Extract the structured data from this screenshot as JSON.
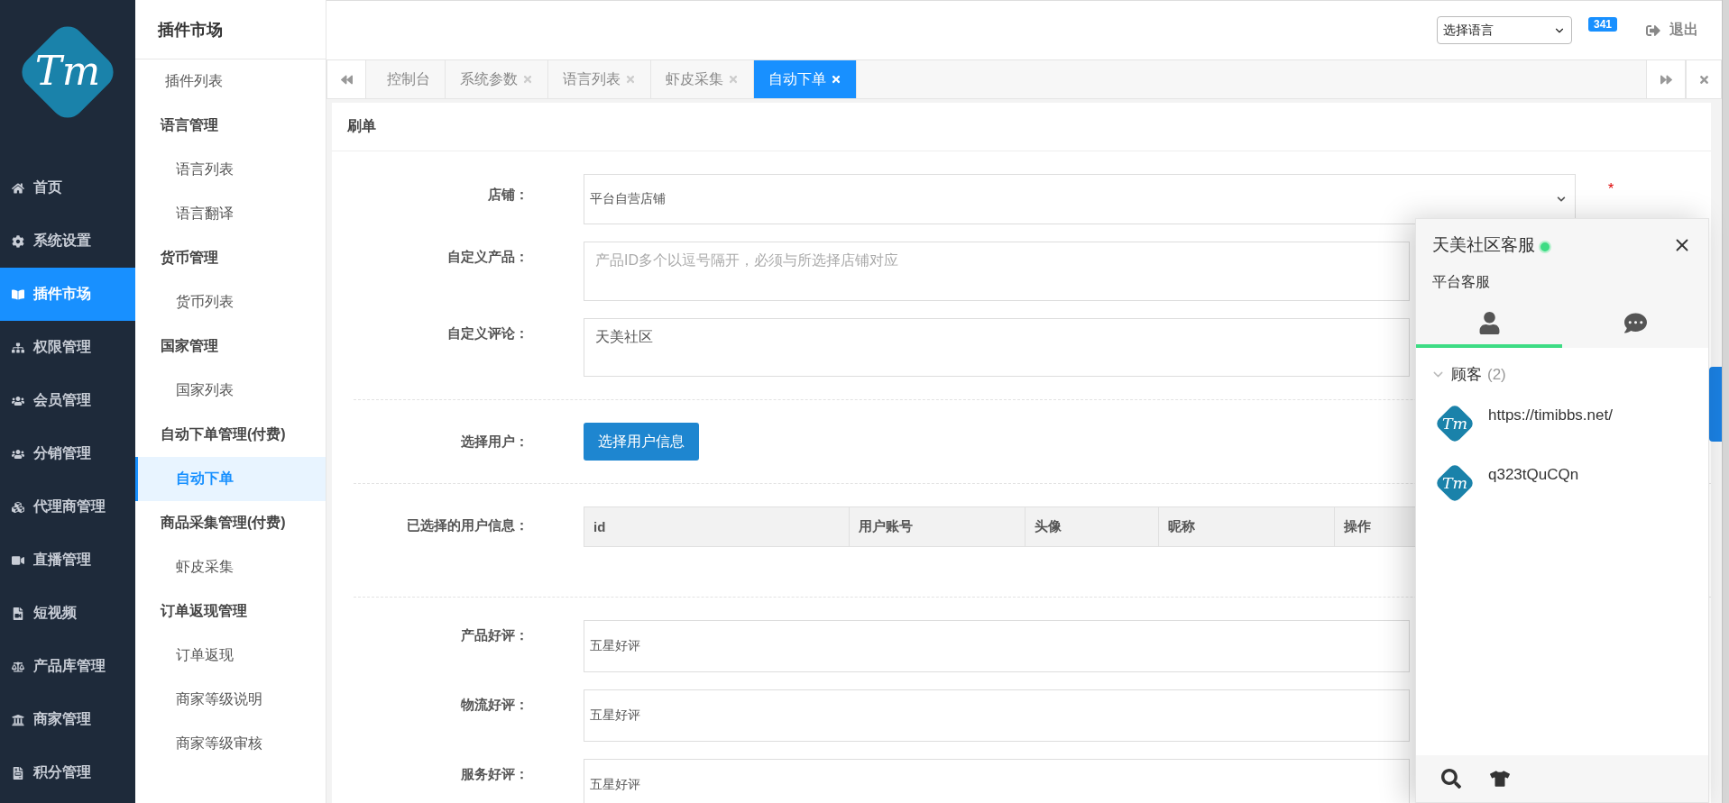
{
  "logo": {
    "text": "Tm"
  },
  "nav": [
    {
      "label": "首页",
      "selected": false
    },
    {
      "label": "系统设置",
      "selected": false
    },
    {
      "label": "插件市场",
      "selected": true
    },
    {
      "label": "权限管理",
      "selected": false
    },
    {
      "label": "会员管理",
      "selected": false
    },
    {
      "label": "分销管理",
      "selected": false
    },
    {
      "label": "代理商管理",
      "selected": false
    },
    {
      "label": "直播管理",
      "selected": false
    },
    {
      "label": "短视频",
      "selected": false
    },
    {
      "label": "产品库管理",
      "selected": false
    },
    {
      "label": "商家管理",
      "selected": false
    },
    {
      "label": "积分管理",
      "selected": false
    }
  ],
  "submenu": {
    "title": "插件市场",
    "items": [
      {
        "kind": "top",
        "label": "插件列表",
        "selected": false
      },
      {
        "kind": "group",
        "label": "语言管理"
      },
      {
        "kind": "sub",
        "label": "语言列表",
        "selected": false
      },
      {
        "kind": "sub",
        "label": "语言翻译",
        "selected": false
      },
      {
        "kind": "group",
        "label": "货币管理"
      },
      {
        "kind": "sub",
        "label": "货币列表",
        "selected": false
      },
      {
        "kind": "group",
        "label": "国家管理"
      },
      {
        "kind": "sub",
        "label": "国家列表",
        "selected": false
      },
      {
        "kind": "group",
        "label": "自动下单管理(付费)"
      },
      {
        "kind": "sub",
        "label": "自动下单",
        "selected": true
      },
      {
        "kind": "group",
        "label": "商品采集管理(付费)"
      },
      {
        "kind": "sub",
        "label": "虾皮采集",
        "selected": false
      },
      {
        "kind": "group",
        "label": "订单返现管理"
      },
      {
        "kind": "sub",
        "label": "订单返现",
        "selected": false
      },
      {
        "kind": "sub",
        "label": "商家等级说明",
        "selected": false
      },
      {
        "kind": "sub",
        "label": "商家等级审核",
        "selected": false
      }
    ]
  },
  "header": {
    "language_select": {
      "value": "选择语言"
    },
    "badge": "341",
    "logout": "退出"
  },
  "tabs": [
    {
      "label": "控制台",
      "closable": false,
      "selected": false
    },
    {
      "label": "系统参数",
      "closable": true,
      "selected": false
    },
    {
      "label": "语言列表",
      "closable": true,
      "selected": false
    },
    {
      "label": "虾皮采集",
      "closable": true,
      "selected": false
    },
    {
      "label": "自动下单",
      "closable": true,
      "selected": true
    }
  ],
  "panel": {
    "title": "刷单",
    "rows": [
      {
        "kind": "select",
        "label": "店铺：",
        "value": "平台自营店铺",
        "required_mark": "*"
      },
      {
        "kind": "textarea",
        "label": "自定义产品：",
        "placeholder": "产品ID多个以逗号隔开，必须与所选择店铺对应"
      },
      {
        "kind": "textarea",
        "label": "自定义评论：",
        "value": "天美社区"
      },
      {
        "kind": "divider"
      },
      {
        "kind": "button",
        "label": "选择用户：",
        "text": "选择用户信息"
      },
      {
        "kind": "divider"
      },
      {
        "kind": "table",
        "label": "已选择的用户信息：",
        "columns": [
          "id",
          "用户账号",
          "头像",
          "昵称",
          "操作"
        ]
      },
      {
        "kind": "divider"
      },
      {
        "kind": "input",
        "label": "产品好评：",
        "value": "五星好评"
      },
      {
        "kind": "input",
        "label": "物流好评：",
        "value": "五星好评"
      },
      {
        "kind": "input",
        "label": "服务好评：",
        "value": "五星好评"
      }
    ]
  },
  "chat": {
    "title": "天美社区客服",
    "online": true,
    "subtitle": "平台客服",
    "tabs": [
      {
        "kind": "contacts",
        "selected": true
      },
      {
        "kind": "messages",
        "selected": false
      }
    ],
    "group": {
      "label": "顾客",
      "count": "(2)",
      "expanded": true
    },
    "contacts": [
      {
        "avatar": "Tm",
        "name": "https://timibbs.net/"
      },
      {
        "avatar": "Tm",
        "name": "q323tQuCQn"
      }
    ]
  }
}
